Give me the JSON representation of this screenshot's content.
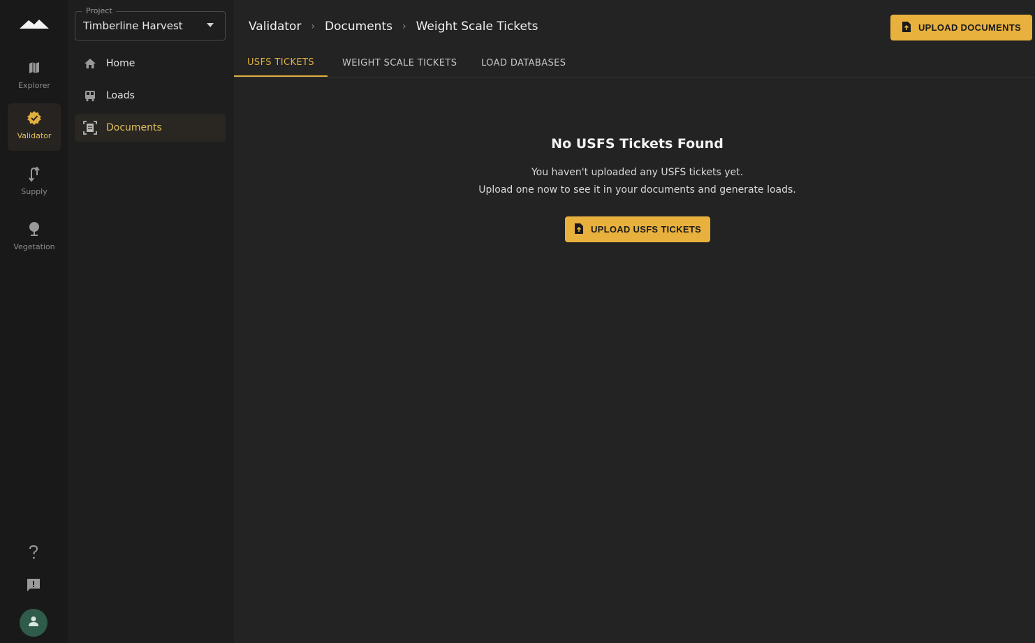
{
  "rail": {
    "items": [
      {
        "label": "Explorer",
        "icon": "map-icon"
      },
      {
        "label": "Validator",
        "icon": "verified-badge-icon"
      },
      {
        "label": "Supply",
        "icon": "route-icon"
      },
      {
        "label": "Vegetation",
        "icon": "tree-icon"
      }
    ],
    "help_icon": "help-icon",
    "feedback_icon": "feedback-icon",
    "avatar_icon": "person-icon"
  },
  "sidebar": {
    "project_legend": "Project",
    "project_value": "Timberline Harvest",
    "items": [
      {
        "label": "Home",
        "icon": "home-icon"
      },
      {
        "label": "Loads",
        "icon": "truck-icon"
      },
      {
        "label": "Documents",
        "icon": "document-scan-icon"
      }
    ]
  },
  "header": {
    "breadcrumb": [
      "Validator",
      "Documents",
      "Weight Scale Tickets"
    ],
    "upload_documents_label": "UPLOAD DOCUMENTS"
  },
  "tabs": [
    {
      "label": "USFS TICKETS",
      "active": true
    },
    {
      "label": "WEIGHT SCALE TICKETS",
      "active": false
    },
    {
      "label": "LOAD DATABASES",
      "active": false
    }
  ],
  "empty_state": {
    "title": "No USFS Tickets Found",
    "line1": "You haven't uploaded any USFS tickets yet.",
    "line2": "Upload one now to see it in your documents and generate loads.",
    "button_label": "UPLOAD USFS TICKETS"
  },
  "colors": {
    "accent": "#e8b13d",
    "background": "#232323",
    "rail": "#191919",
    "sidebar": "#1e1e1e"
  }
}
